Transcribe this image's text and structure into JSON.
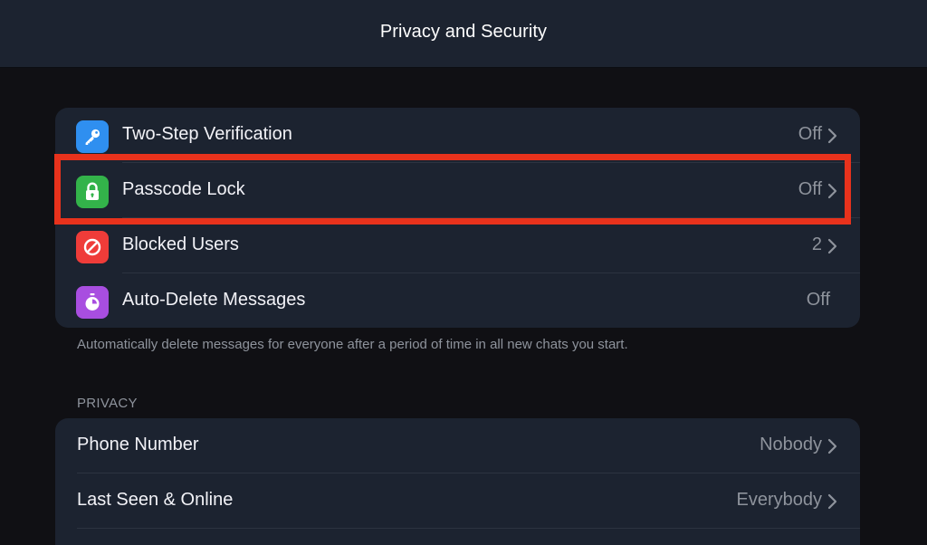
{
  "header": {
    "title": "Privacy and Security"
  },
  "security": {
    "items": [
      {
        "label": "Two-Step Verification",
        "value": "Off",
        "icon": "key-icon",
        "color": "#2f8ff0"
      },
      {
        "label": "Passcode Lock",
        "value": "Off",
        "icon": "lock-icon",
        "color": "#33b34a"
      },
      {
        "label": "Blocked Users",
        "value": "2",
        "icon": "block-icon",
        "color": "#ef3c39"
      },
      {
        "label": "Auto-Delete Messages",
        "value": "Off",
        "icon": "timer-icon",
        "color": "#a84ee0"
      }
    ],
    "footnote": "Automatically delete messages for everyone after a period of time in all new chats you start."
  },
  "privacy": {
    "header": "PRIVACY",
    "items": [
      {
        "label": "Phone Number",
        "value": "Nobody"
      },
      {
        "label": "Last Seen & Online",
        "value": "Everybody"
      }
    ]
  },
  "colors": {
    "accent_highlight": "#e8321c",
    "background": "#101014",
    "group_background": "#1c2330",
    "secondary_text": "#8e939c"
  }
}
